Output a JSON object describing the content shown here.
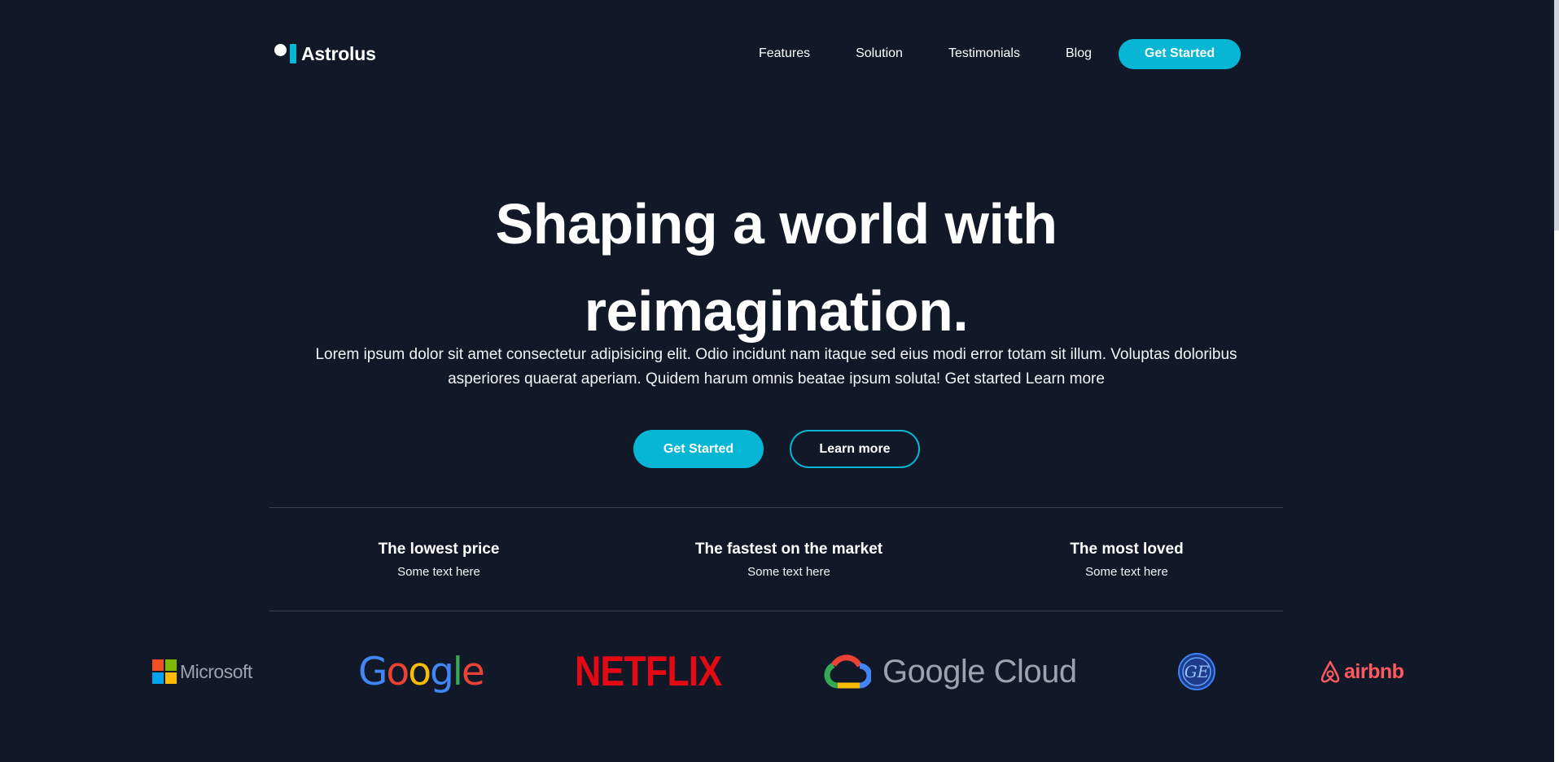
{
  "brand": {
    "name": "Astrolus",
    "accent_color": "#06b6d4",
    "background_color": "#111827"
  },
  "nav": {
    "links": [
      "Features",
      "Solution",
      "Testimonials",
      "Blog"
    ],
    "cta_label": "Get Started"
  },
  "hero": {
    "title_line1": "Shaping a world with",
    "title_line2": "reimagination.",
    "subtitle": "Lorem ipsum dolor sit amet consectetur adipisicing elit. Odio incidunt nam itaque sed eius modi error totam sit illum. Voluptas doloribus asperiores quaerat aperiam. Quidem harum omnis beatae ipsum soluta! Get started Learn more",
    "primary_button": "Get Started",
    "secondary_button": "Learn more"
  },
  "features": [
    {
      "title": "The lowest price",
      "text": "Some text here"
    },
    {
      "title": "The fastest on the market",
      "text": "Some text here"
    },
    {
      "title": "The most loved",
      "text": "Some text here"
    }
  ],
  "logos": {
    "microsoft": "Microsoft",
    "google": "Google",
    "netflix": "NETFLIX",
    "google_cloud": "Google Cloud",
    "ge": "GE",
    "airbnb": "airbnb"
  }
}
